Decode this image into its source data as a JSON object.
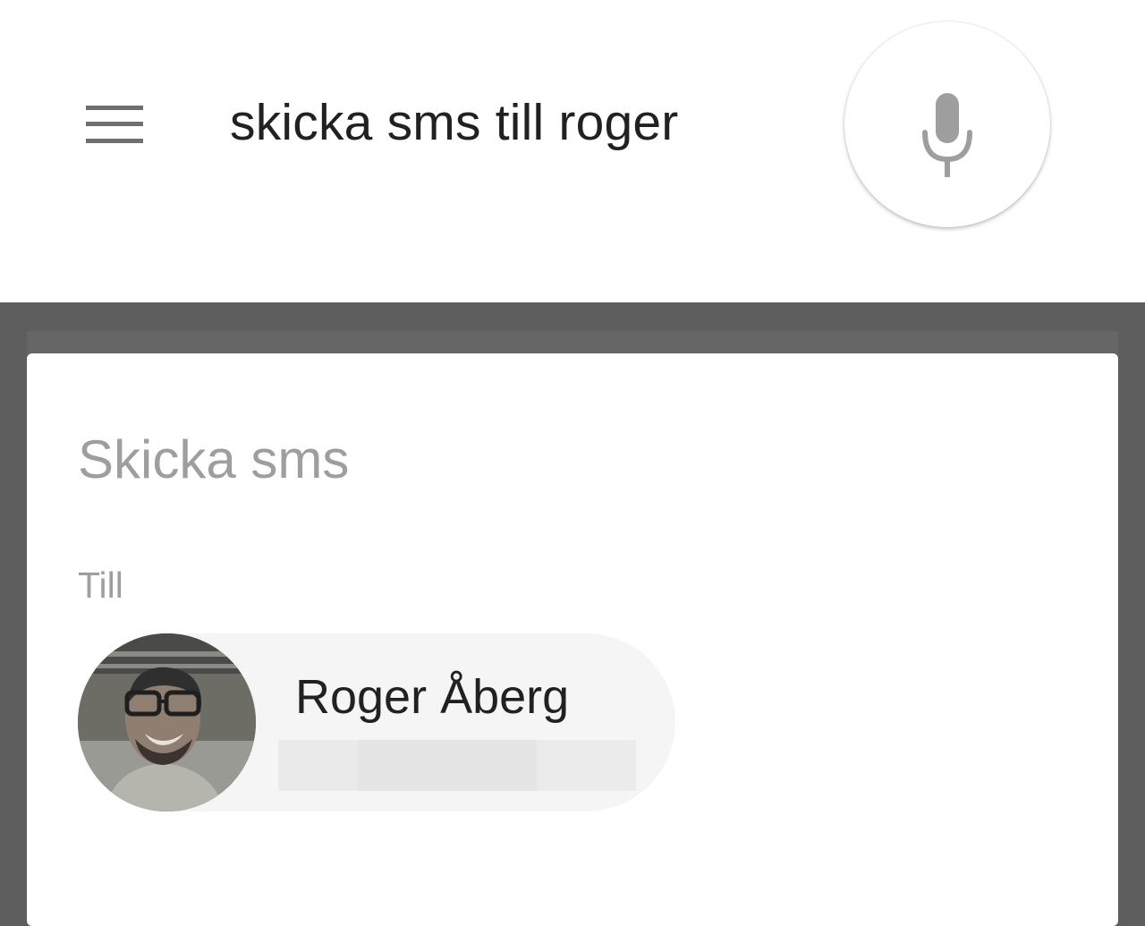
{
  "search": {
    "query": "skicka sms till roger",
    "menu_icon": "menu-icon",
    "mic_icon": "microphone-icon"
  },
  "card": {
    "title": "Skicka sms",
    "to_label": "Till",
    "contact": {
      "name": "Roger Åberg"
    }
  },
  "colors": {
    "background": "#5e5e5e",
    "surface": "#ffffff",
    "chip": "#f5f5f5",
    "secondary_text": "#9e9e9e",
    "primary_text": "#212121"
  }
}
